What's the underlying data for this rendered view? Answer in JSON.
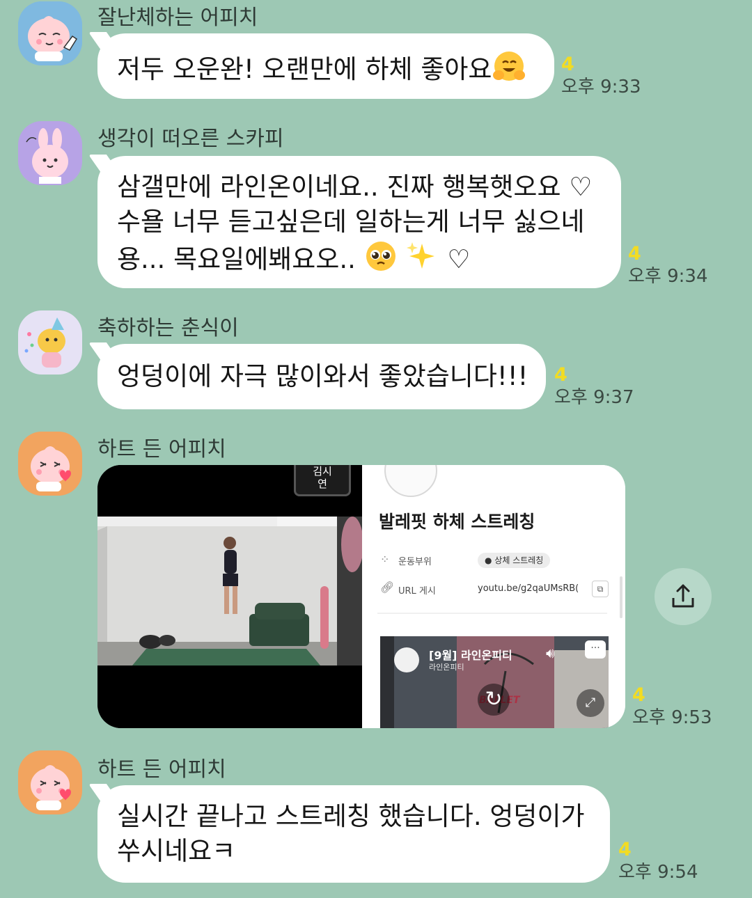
{
  "messages": [
    {
      "sender": "잘난체하는 어피치",
      "lines": [
        "저두 오운완! 오랜만에 하체 좋아요"
      ],
      "emoji": "hugging-face",
      "unread": "4",
      "time": "오후 9:33"
    },
    {
      "sender": "생각이 떠오른 스카피",
      "lines": [
        "삼갤만에 라인온이네요.. 진짜 행복햇오요 ♡",
        "수욜 너무 듣고싶은데 일하는게 너무 싫으네",
        "용... 목요일에봬요오.."
      ],
      "trailing": "♡",
      "unread": "4",
      "time": "오후 9:34"
    },
    {
      "sender": "축하하는 춘식이",
      "lines": [
        "엉덩이에 자극 많이와서 좋았습니다!!!"
      ],
      "unread": "4",
      "time": "오후 9:37"
    },
    {
      "sender": "하트 든 어피치",
      "unread": "4",
      "time": "오후 9:53",
      "photo": {
        "badge_line1": "김시",
        "badge_line2": "연",
        "title": "발레핏 하체 스트레칭",
        "field1_label": "운동부위",
        "field1_value": "상체 스트레칭",
        "field2_label": "URL 게시",
        "field2_value": "youtu.be/g2qaUMsRB(",
        "video_title": "[9월] 라인온피티",
        "video_channel": "라인온피티",
        "watermark": "BALLET"
      }
    },
    {
      "sender": "하트 든 어피치",
      "lines": [
        "실시간 끝나고 스트레칭 했습니다. 엉덩이가",
        "쑤시네요ㅋ"
      ],
      "unread": "4",
      "time": "오후 9:54"
    }
  ],
  "colors": {
    "background": "#9dc8b4",
    "bubble": "#ffffff",
    "unread": "#f2dc23"
  }
}
